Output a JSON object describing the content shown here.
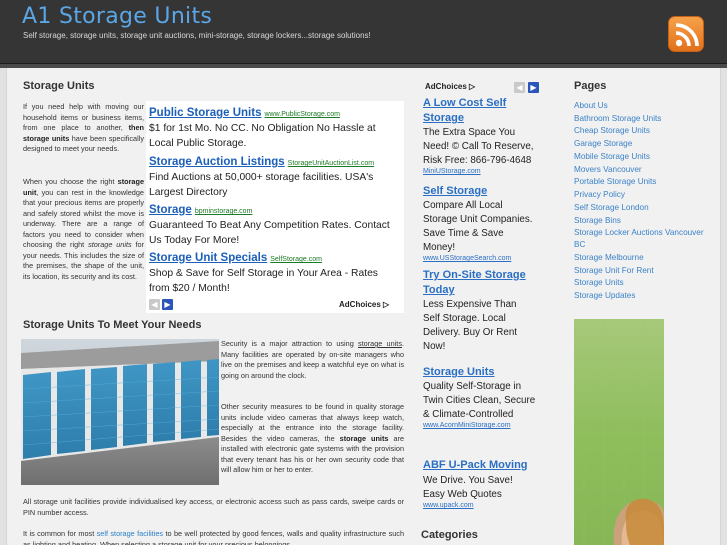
{
  "header": {
    "title": "A1 Storage Units",
    "description": "Self storage, storage units, storage unit auctions, mini-storage, storage lockers...storage solutions!",
    "rss_icon": "rss-icon",
    "colors": {
      "background": "#353535",
      "title": "#5aa6e6",
      "rss": "#e2701a"
    }
  },
  "main": {
    "heading1": "Storage Units",
    "intro_p1_a": "If you need help with moving our household items or business items, from one place to another,",
    "intro_p1_b": "then storage units",
    "intro_p1_c": "have been specifically designed to meet your needs.",
    "intro_p2_a": "When you choose the right",
    "intro_p2_b": "storage unit",
    "intro_p2_c": ", you can rest in the knowledge that your precious items are properly and safely stored whilst the move is underway. There are a range of factors you need to consider when choosing the right",
    "intro_p2_d": "storage units",
    "intro_p2_e": "for your needs. This includes the size of the premises, the shape of the unit, its location, its security and its cost.",
    "heading2": "Storage Units To Meet Your Needs",
    "sec_p1_a": "Security is a major attraction to using",
    "sec_p1_link": "storage units",
    "sec_p1_b": ". Many facilities are operated by on-site managers who live on the premises and keep a watchful eye on what is going on around the clock.",
    "sec_p2_a": "Other security measures to be found in quality storage units include video cameras that always keep watch, especially at the entrance into the storage facility. Besides the video cameras, the",
    "sec_p2_b": "storage units",
    "sec_p2_c": "are installed with electronic gate systems with the provision that every tenant has his or her own security code that will allow him or her to enter.",
    "sec_p3": "All storage unit facilities provide individualised key access, or electronic access such as pass cards, sweipe cards or PIN number access.",
    "sec_p4_a": "It is common for most",
    "sec_p4_link": "self storage facilities",
    "sec_p4_b": "to be well protected by good fences, walls and quality infrastructure such as lighting and heating. When selecting a storage unit for your precious belongings,"
  },
  "adblock1": {
    "adchoices": "AdChoices",
    "ads": [
      {
        "title": "Public Storage Units",
        "url": "www.PublicStorage.com",
        "text": "$1 for 1st Mo. No CC. No Obligation No Hassle at Local Public Storage."
      },
      {
        "title": "Storage Auction Listings",
        "url": "StorageUnitAuctionList.com",
        "text": "Find Auctions at 50,000+ storage facilities. USA's Largest Directory"
      },
      {
        "title": "Storage",
        "url": "bpminstorage.com",
        "text": "Guaranteed To Beat Any Competition Rates. Contact Us Today For More!"
      },
      {
        "title": "Storage Unit Specials",
        "url": "SelfStorage.com",
        "text": "Shop & Save for Self Storage in Your Area - Rates from $20 / Month!"
      }
    ]
  },
  "adblock2": {
    "adchoices": "AdChoices",
    "ads": [
      {
        "title1": "A Low Cost Self",
        "title2": "Storage",
        "lines": [
          "The Extra Space You",
          "Need! © Call To Reserve,",
          "Risk Free: 866-796-4648"
        ],
        "url": "MiniUStorage.com"
      },
      {
        "title1": "Self Storage",
        "title2": "",
        "lines": [
          "Compare All Local",
          "Storage Unit Companies.",
          "Save Time & Save",
          "Money!"
        ],
        "url": "www.USStorageSearch.com"
      },
      {
        "title1": "Try On-Site Storage",
        "title2": "Today",
        "lines": [
          "Less Expensive Than",
          "Self Storage. Local",
          "Delivery. Buy Or Rent",
          "Now!"
        ],
        "url": ""
      },
      {
        "title1": "Storage Units",
        "title2": "",
        "lines": [
          "Quality Self-Storage in",
          "Twin Cities Clean, Secure",
          "& Climate-Controlled"
        ],
        "url": "www.AcornMiniStorage.com"
      },
      {
        "title1": "ABF U-Pack Moving",
        "title2": "",
        "lines": [
          "We Drive. You Save!",
          "Easy Web Quotes"
        ],
        "url": "www.upack.com"
      }
    ],
    "categories_heading": "Categories"
  },
  "sidebar": {
    "heading": "Pages",
    "links": [
      "About Us",
      "Bathroom Storage Units",
      "Cheap Storage Units",
      "Garage Storage",
      "Mobile Storage Units",
      "Movers Vancouver",
      "Portable Storage Units",
      "Privacy Policy",
      "Self Storage London",
      "Storage Bins",
      "Storage Locker Auctions Vancouver",
      "BC",
      "Storage Melbourne",
      "Storage Unit For Rent",
      "Storage Units",
      "Storage Updates"
    ]
  }
}
